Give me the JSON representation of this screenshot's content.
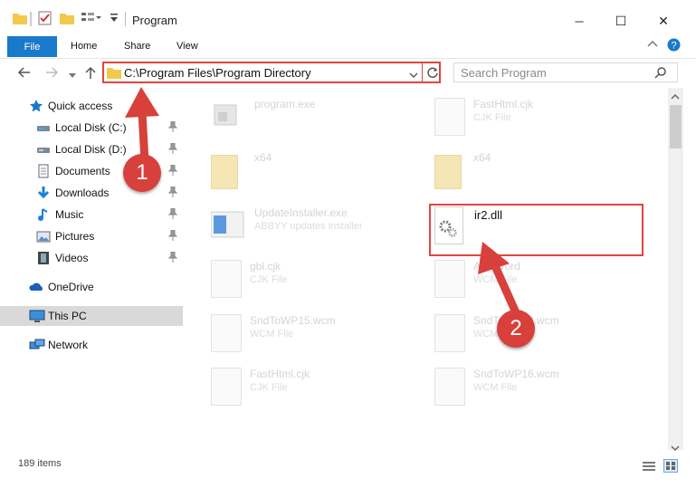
{
  "window": {
    "title": "Program",
    "minimize_glyph": "─",
    "maximize_glyph": "☐",
    "close_glyph": "✕"
  },
  "ribbon": {
    "tabs": [
      "File",
      "Home",
      "Share",
      "View"
    ],
    "accent": "#1979ca"
  },
  "address": {
    "path": "C:\\Program Files\\Program Directory",
    "search_placeholder": "Search Program"
  },
  "nav": {
    "quick_access": "Quick access",
    "items": [
      {
        "label": "Local Disk (C:)",
        "icon": "drive-icon",
        "pinned": true
      },
      {
        "label": "Local Disk (D:)",
        "icon": "drive-icon",
        "pinned": true
      },
      {
        "label": "Documents",
        "icon": "documents-icon",
        "pinned": true
      },
      {
        "label": "Downloads",
        "icon": "downloads-icon",
        "pinned": true
      },
      {
        "label": "Music",
        "icon": "music-icon",
        "pinned": true
      },
      {
        "label": "Pictures",
        "icon": "pictures-icon",
        "pinned": true
      },
      {
        "label": "Videos",
        "icon": "videos-icon",
        "pinned": true
      }
    ],
    "onedrive": "OneDrive",
    "thispc": "This PC",
    "network": "Network"
  },
  "files": [
    {
      "name": "program.exe",
      "type": "",
      "icon": "exe-icon"
    },
    {
      "name": "FastHtml.cjk",
      "type": "CJK File",
      "icon": "document-icon"
    },
    {
      "name": "x64",
      "type": "",
      "icon": "folder-icon"
    },
    {
      "name": "x64",
      "type": "",
      "icon": "folder-icon"
    },
    {
      "name": "UpdateInstaller.exe",
      "type": "ABBYY updates installer",
      "icon": "installer-icon"
    },
    {
      "name": "ir2.dll",
      "type": "",
      "icon": "dll-gear-icon"
    },
    {
      "name": "gbl.cjk",
      "type": "CJK File",
      "icon": "document-icon"
    },
    {
      "name": "AnsiWord",
      "type": "WCM File",
      "icon": "document-icon"
    },
    {
      "name": "SndToWP15.wcm",
      "type": "WCM File",
      "icon": "document-icon"
    },
    {
      "name": "SndToWP12.wcm",
      "type": "WCM File",
      "icon": "document-icon"
    },
    {
      "name": "FastHtml.cjk",
      "type": "CJK File",
      "icon": "document-icon"
    },
    {
      "name": "SndToWP16.wcm",
      "type": "WCM File",
      "icon": "document-icon"
    }
  ],
  "status": {
    "item_count": "189 items"
  },
  "annotations": {
    "step1": "1",
    "step2": "2",
    "color": "#d8403b"
  }
}
